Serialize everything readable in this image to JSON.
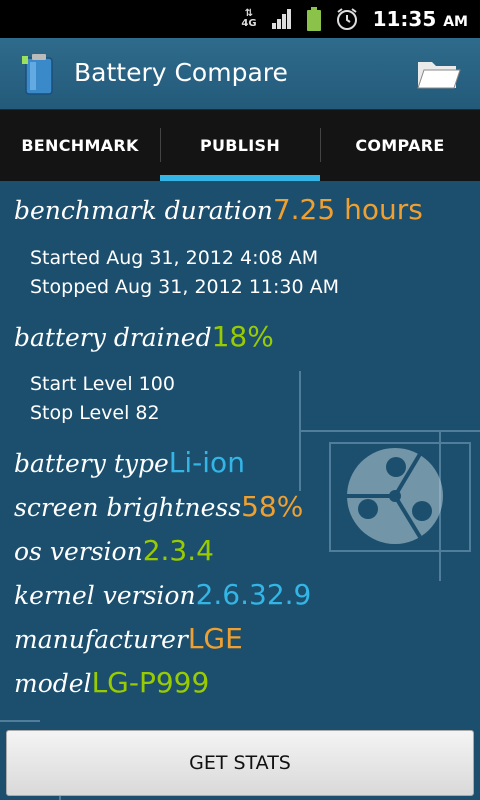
{
  "status_bar": {
    "network": "4G",
    "time": "11:35",
    "ampm": "AM",
    "icons": [
      "data-arrows-icon",
      "signal-icon",
      "battery-icon",
      "alarm-icon"
    ]
  },
  "app": {
    "title": "Battery Compare",
    "icon": "battery-icon",
    "action_icon": "folder-icon"
  },
  "tabs": [
    {
      "label": "BENCHMARK",
      "active": false
    },
    {
      "label": "PUBLISH",
      "active": true
    },
    {
      "label": "COMPARE",
      "active": false
    }
  ],
  "colors": {
    "accent": "#33b5e5",
    "orange": "#f0a030",
    "green": "#99cc00",
    "background": "#1c4f6e"
  },
  "stats": {
    "duration": {
      "label": "benchmark duration",
      "value": "7.25 hours"
    },
    "started": "Started Aug 31, 2012 4:08 AM",
    "stopped": "Stopped Aug 31, 2012 11:30 AM",
    "drained": {
      "label": "battery drained",
      "value": "18%"
    },
    "start_level": "Start Level 100",
    "stop_level": "Stop Level 82",
    "battery_type": {
      "label": "battery type",
      "value": "Li-ion"
    },
    "brightness": {
      "label": "screen brightness",
      "value": "58%"
    },
    "os_version": {
      "label": "os version",
      "value": "2.3.4"
    },
    "kernel_version": {
      "label": "kernel version",
      "value": "2.6.32.9"
    },
    "manufacturer": {
      "label": "manufacturer",
      "value": "LGE"
    },
    "model": {
      "label": "model",
      "value": "LG-P999"
    }
  },
  "button": {
    "label": "GET STATS"
  }
}
